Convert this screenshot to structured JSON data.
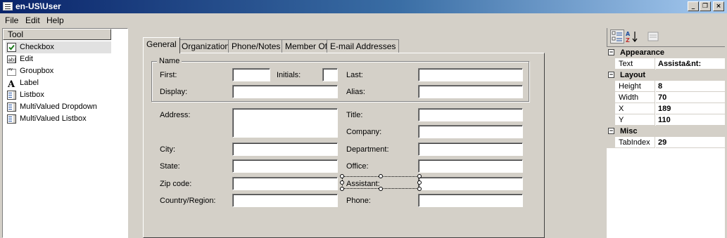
{
  "window": {
    "title": "en-US\\User",
    "minimize_glyph": "_",
    "restore_glyph": "❐",
    "close_glyph": "×"
  },
  "menu": [
    "File",
    "Edit",
    "Help"
  ],
  "tools": {
    "header": "Tool",
    "items": [
      {
        "label": "Checkbox",
        "icon": "checkbox-icon",
        "selected": true
      },
      {
        "label": "Edit",
        "icon": "edit-icon"
      },
      {
        "label": "Groupbox",
        "icon": "groupbox-icon"
      },
      {
        "label": "Label",
        "icon": "label-icon"
      },
      {
        "label": "Listbox",
        "icon": "listbox-icon"
      },
      {
        "label": "MultiValued Dropdown",
        "icon": "dropdown-icon"
      },
      {
        "label": "MultiValued Listbox",
        "icon": "listbox-icon"
      }
    ]
  },
  "tabs": [
    "General",
    "Organization",
    "Phone/Notes",
    "Member Of",
    "E-mail Addresses"
  ],
  "form": {
    "group_label": "Name",
    "first": "First:",
    "initials": "Initials:",
    "last": "Last:",
    "display": "Display:",
    "alias": "Alias:",
    "address": "Address:",
    "title": "Title:",
    "company": "Company:",
    "city": "City:",
    "department": "Department:",
    "state": "State:",
    "office": "Office:",
    "zip": "Zip code:",
    "assistant": "Assistant:",
    "country": "Country/Region:",
    "phone": "Phone:"
  },
  "properties": {
    "categories": [
      {
        "name": "Appearance",
        "rows": [
          {
            "name": "Text",
            "value": "Assista&nt:"
          }
        ]
      },
      {
        "name": "Layout",
        "rows": [
          {
            "name": "Height",
            "value": "8"
          },
          {
            "name": "Width",
            "value": "70"
          },
          {
            "name": "X",
            "value": "189"
          },
          {
            "name": "Y",
            "value": "110"
          }
        ]
      },
      {
        "name": "Misc",
        "rows": [
          {
            "name": "TabIndex",
            "value": "29"
          }
        ]
      }
    ]
  },
  "colors": {
    "titlebar_start": "#0a246a",
    "titlebar_end": "#a6caf0",
    "face": "#d4d0c8"
  }
}
